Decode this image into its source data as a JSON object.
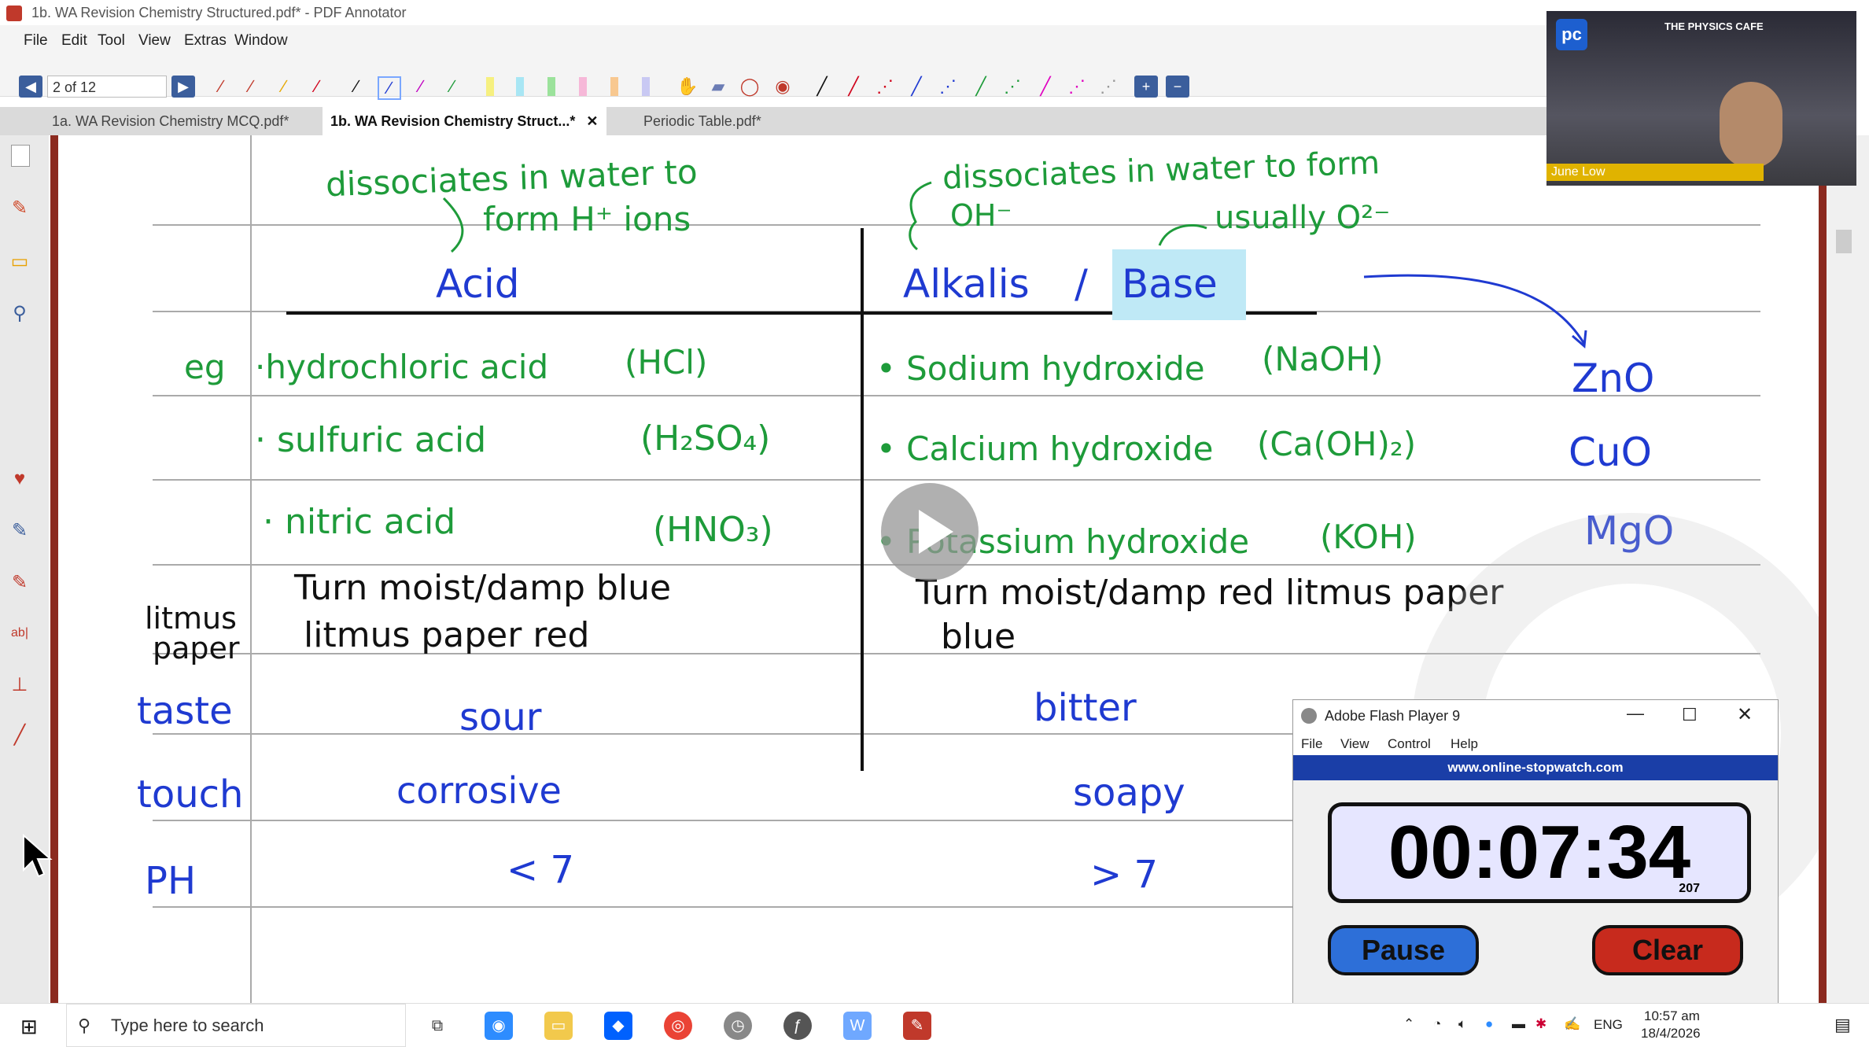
{
  "window": {
    "title": "1b. WA Revision Chemistry Structured.pdf* - PDF Annotator"
  },
  "menu": [
    "File",
    "Edit",
    "Tool",
    "View",
    "Extras",
    "Window"
  ],
  "toolbar": {
    "page_value": "2 of 12"
  },
  "tabs": [
    {
      "label": "1a. WA Revision Chemistry MCQ.pdf*"
    },
    {
      "label": "1b. WA Revision Chemistry Struct...*",
      "close": "✕"
    },
    {
      "label": "Periodic Table.pdf*"
    }
  ],
  "notes": {
    "acid_note1": "dissociates in water to",
    "acid_note2": "form H⁺ ions",
    "base_note1": "dissociates in water to form",
    "base_note2": "OH⁻",
    "base_note3": "usually O²⁻",
    "header_acid": "Acid",
    "header_alkali": "Alkalis",
    "header_slash": "/",
    "header_base": "Base",
    "row_eg": "eg",
    "acid1": "·hydrochloric acid",
    "acid1f": "(HCl)",
    "acid2": "· sulfuric acid",
    "acid2f": "(H₂SO₄)",
    "acid3": "· nitric acid",
    "acid3f": "(HNO₃)",
    "base1": "• Sodium hydroxide",
    "base1f": "(NaOH)",
    "base2": "• Calcium hydroxide",
    "base2f": "(Ca(OH)₂)",
    "base3": "• Potassium hydroxide",
    "base3f": "(KOH)",
    "oxide1": "ZnO",
    "oxide2": "CuO",
    "oxide3": "MgO",
    "row_litmus1": "litmus",
    "row_litmus2": "paper",
    "acid_litmus1": "Turn moist/damp blue",
    "acid_litmus2": "litmus paper red",
    "base_litmus1": "Turn moist/damp red litmus paper",
    "base_litmus2": "blue",
    "row_taste": "taste",
    "acid_taste": "sour",
    "base_taste": "bitter",
    "row_touch": "touch",
    "acid_touch": "corrosive",
    "base_touch": "soapy",
    "row_ph": "PH",
    "acid_ph": "< 7",
    "base_ph": "> 7"
  },
  "video": {
    "logo": "pc",
    "brand": "THE PHYSICS CAFE",
    "presenter": "June Low"
  },
  "flash": {
    "title": "Adobe Flash Player 9",
    "menu": [
      "File",
      "View",
      "Control",
      "Help"
    ],
    "url": "www.online-stopwatch.com",
    "time": "00:07:34",
    "ms": "207",
    "pause": "Pause",
    "clear": "Clear"
  },
  "taskbar": {
    "search_placeholder": "Type here to search",
    "lang": "ENG",
    "time": "10:57 am",
    "date": "18/4/2026"
  },
  "colors": {
    "green_ink": "#1e9b3a",
    "blue_ink": "#1f3ad1",
    "highlight": "#bfe9f6"
  }
}
